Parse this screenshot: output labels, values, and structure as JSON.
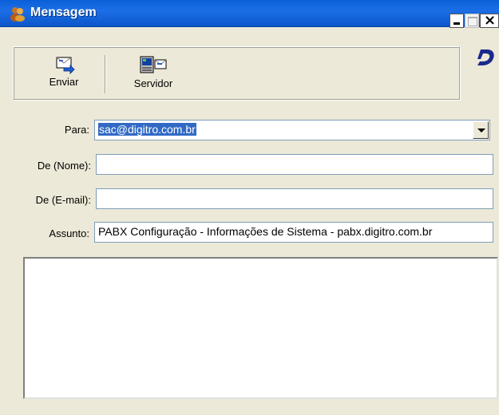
{
  "window": {
    "title": "Mensagem"
  },
  "toolbar": {
    "enviar_label": "Enviar",
    "servidor_label": "Servidor"
  },
  "form": {
    "para_label": "Para:",
    "para_value": "sac@digitro.com.br",
    "de_nome_label": "De (Nome):",
    "de_nome_value": "",
    "de_email_label": "De (E-mail):",
    "de_email_value": "",
    "assunto_label": "Assunto:",
    "assunto_value": "PABX Configuração - Informações de Sistema - pabx.digitro.com.br"
  },
  "colors": {
    "title_bar": "#0a5fd8",
    "selection": "#316ac5",
    "window_bg": "#ece9d8"
  },
  "icons": [
    "app-people-icon",
    "envelope-send-icon",
    "server-computer-icon",
    "digitro-logo-icon"
  ]
}
